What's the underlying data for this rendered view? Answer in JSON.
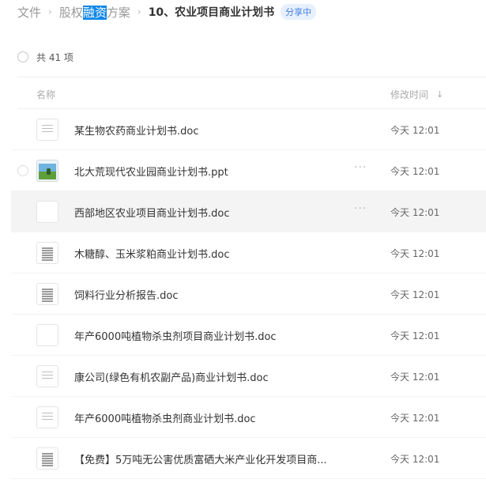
{
  "breadcrumb": {
    "root": "文件",
    "parent_prefix": "股权",
    "parent_highlight": "融资",
    "parent_suffix": "方案",
    "current": "10、农业项目商业计划书",
    "share_badge": "分享中",
    "separator": "›"
  },
  "summary": {
    "count_label": "共 41 项"
  },
  "columns": {
    "name": "名称",
    "modified": "修改时间",
    "sort_icon": "arrow-down-icon"
  },
  "more_icon_glyph": "···",
  "files": [
    {
      "name": "某生物农药商业计划书.doc",
      "time": "今天 12:01",
      "thumb": "doc"
    },
    {
      "name": "北大荒现代农业园商业计划书.ppt",
      "time": "今天 12:01",
      "thumb": "ppt"
    },
    {
      "name": "西部地区农业项目商业计划书.doc",
      "time": "今天 12:01",
      "thumb": "blank"
    },
    {
      "name": "木糖醇、玉米浆粕商业计划书.doc",
      "time": "今天 12:01",
      "thumb": "dense"
    },
    {
      "name": "饲料行业分析报告.doc",
      "time": "今天 12:01",
      "thumb": "dense"
    },
    {
      "name": "年产6000吨植物杀虫剂项目商业计划书.doc",
      "time": "今天 12:01",
      "thumb": "blank"
    },
    {
      "name": "康公司(绿色有机农副产品)商业计划书.doc",
      "time": "今天 12:01",
      "thumb": "doc"
    },
    {
      "name": "年产6000吨植物杀虫剂商业计划书.doc",
      "time": "今天 12:01",
      "thumb": "doc"
    },
    {
      "name": "【免费】5万吨无公害优质富硒大米产业化开发项目商...",
      "time": "今天 12:01",
      "thumb": "dense"
    }
  ]
}
